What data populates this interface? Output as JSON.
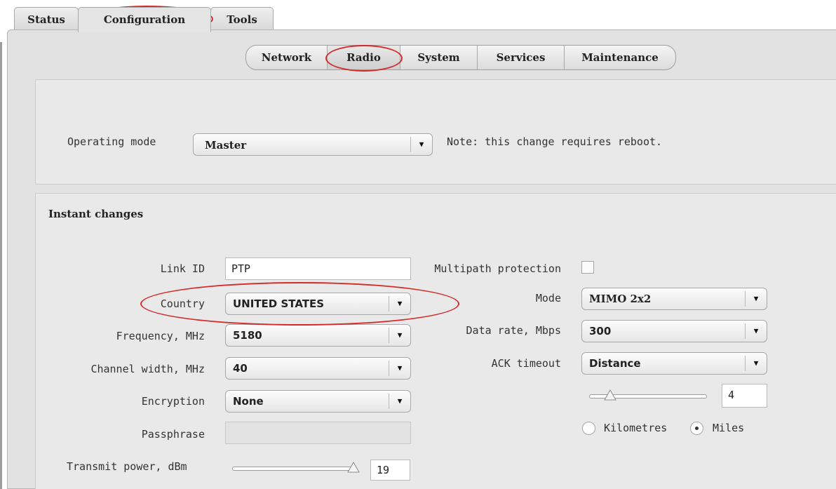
{
  "top_tabs": [
    {
      "label": "Status",
      "active": false
    },
    {
      "label": "Configuration",
      "active": true
    },
    {
      "label": "Tools",
      "active": false
    }
  ],
  "sub_tabs": [
    {
      "label": "Network",
      "active": false
    },
    {
      "label": "Radio",
      "active": true
    },
    {
      "label": "System",
      "active": false
    },
    {
      "label": "Services",
      "active": false
    },
    {
      "label": "Maintenance",
      "active": false
    }
  ],
  "operating_mode": {
    "label": "Operating mode",
    "value": "Master",
    "note": "Note: this change requires reboot."
  },
  "instant_changes": {
    "title": "Instant changes",
    "link_id": {
      "label": "Link ID",
      "value": "PTP"
    },
    "country": {
      "label": "Country",
      "value": "UNITED STATES"
    },
    "frequency": {
      "label": "Frequency, MHz",
      "value": "5180"
    },
    "channel_width": {
      "label": "Channel width, MHz",
      "value": "40"
    },
    "encryption": {
      "label": "Encryption",
      "value": "None"
    },
    "passphrase": {
      "label": "Passphrase",
      "value": ""
    },
    "transmit_power": {
      "label": "Transmit power, dBm",
      "value": "19",
      "slider_fraction": 0.97
    },
    "multipath": {
      "label": "Multipath protection",
      "checked": false
    },
    "mode": {
      "label": "Mode",
      "value": "MIMO 2x2"
    },
    "data_rate": {
      "label": "Data rate, Mbps",
      "value": "300"
    },
    "ack_timeout": {
      "label": "ACK timeout",
      "value": "Distance"
    },
    "distance": {
      "value": "4",
      "slider_fraction": 0.18
    },
    "units": {
      "kilometres": {
        "label": "Kilometres",
        "selected": false
      },
      "miles": {
        "label": "Miles",
        "selected": true
      }
    }
  },
  "icons": {
    "dropdown_arrow": "▼"
  },
  "colors": {
    "annotation": "#d42a2a",
    "frame": "#e2e2e2",
    "panel": "#e9e9e9"
  }
}
